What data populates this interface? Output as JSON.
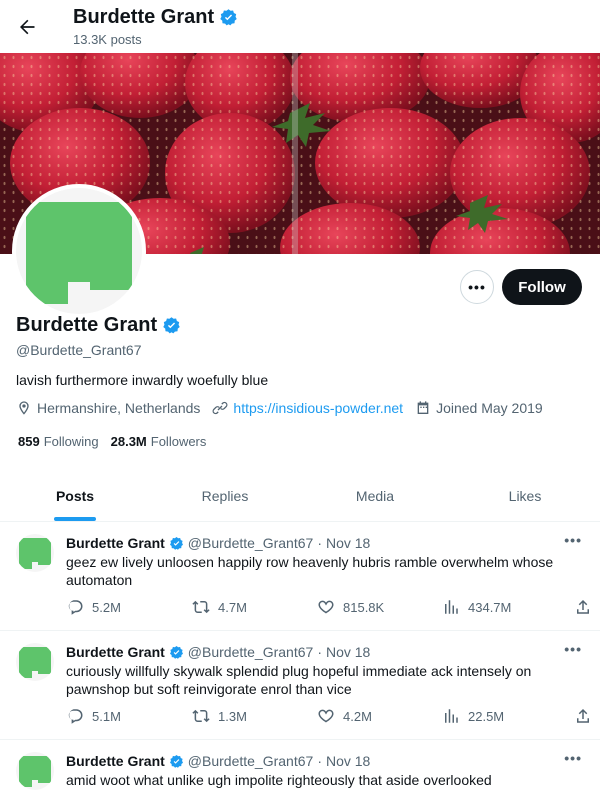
{
  "header": {
    "name": "Burdette Grant",
    "posts_count": "13.3K posts"
  },
  "profile": {
    "name": "Burdette Grant",
    "handle": "@Burdette_Grant67",
    "bio": "lavish furthermore inwardly woefully blue",
    "location": "Hermanshire, Netherlands",
    "website": "https://insidious-powder.net",
    "joined": "Joined May 2019",
    "following_count": "859",
    "following_label": "Following",
    "followers_count": "28.3M",
    "followers_label": "Followers",
    "follow_button": "Follow",
    "more_button": "•••",
    "avatar_color": "#5ec46b",
    "verified_color": "#1d9bf0"
  },
  "tabs": [
    {
      "label": "Posts",
      "active": true
    },
    {
      "label": "Replies",
      "active": false
    },
    {
      "label": "Media",
      "active": false
    },
    {
      "label": "Likes",
      "active": false
    }
  ],
  "tweets": [
    {
      "name": "Burdette Grant",
      "handle": "@Burdette_Grant67",
      "separator": "·",
      "date": "Nov 18",
      "text": "geez ew lively unloosen happily row heavenly hubris ramble overwhelm whose automaton",
      "replies": "5.2M",
      "retweets": "4.7M",
      "likes": "815.8K",
      "views": "434.7M"
    },
    {
      "name": "Burdette Grant",
      "handle": "@Burdette_Grant67",
      "separator": "·",
      "date": "Nov 18",
      "text": "curiously willfully skywalk splendid plug hopeful immediate ack intensely on pawnshop but soft reinvigorate enrol than vice",
      "replies": "5.1M",
      "retweets": "1.3M",
      "likes": "4.2M",
      "views": "22.5M"
    },
    {
      "name": "Burdette Grant",
      "handle": "@Burdette_Grant67",
      "separator": "·",
      "date": "Nov 18",
      "text": "amid woot what unlike ugh impolite righteously that aside overlooked",
      "replies": "",
      "retweets": "",
      "likes": "",
      "views": ""
    }
  ],
  "icons": {
    "back": "arrow-left-icon",
    "verified": "verified-badge-icon",
    "location": "location-pin-icon",
    "link": "link-icon",
    "calendar": "calendar-icon",
    "reply": "reply-icon",
    "retweet": "retweet-icon",
    "like": "heart-icon",
    "views": "views-chart-icon",
    "share": "share-icon"
  }
}
